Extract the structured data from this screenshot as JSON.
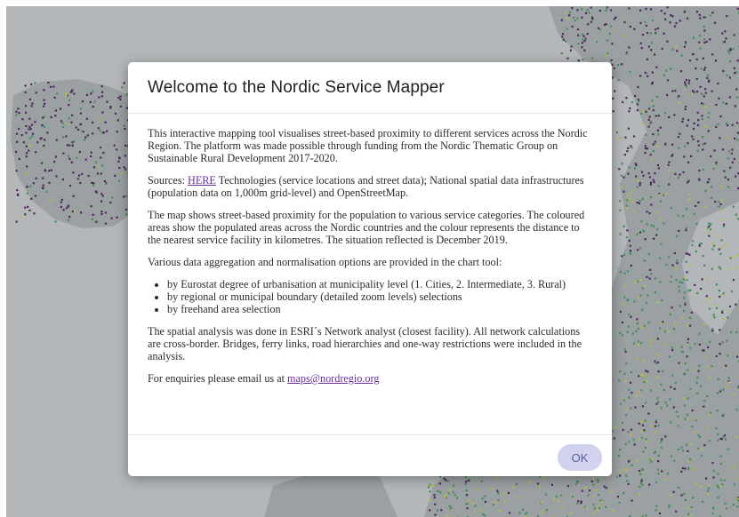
{
  "modal": {
    "title": "Welcome to the Nordic Service Mapper",
    "intro": "This interactive mapping tool visualises street-based proximity to different services across the Nordic Region. The platform was made possible through funding from the Nordic Thematic Group on Sustainable Rural Development 2017-2020.",
    "sources_prefix": "Sources: ",
    "sources_link": "HERE",
    "sources_rest": " Technologies (service locations and street data); National spatial data infrastructures (population data on 1,000m grid-level) and OpenStreetMap.",
    "map_description": "The map shows street-based proximity for the population to various service categories. The coloured areas show the populated areas across the Nordic countries and the colour represents the distance to the nearest service facility in kilometres. The situation reflected is December 2019.",
    "aggregation_intro": "Various data aggregation and normalisation options are provided in the chart tool:",
    "aggregation_options": [
      "by Eurostat degree of urbanisation at municipality level (1. Cities, 2. Intermediate, 3. Rural)",
      "by regional or municipal boundary (detailed zoom levels) selections",
      "by freehand area selection"
    ],
    "analysis_note": "The spatial analysis was done in ESRI´s Network analyst (closest facility). All network calculations are cross-border. Bridges, ferry links, road hierarchies and one-way restrictions were included in the analysis.",
    "enquiries_prefix": "For enquiries please email us at ",
    "enquiries_email": "maps@nordregio.org",
    "ok_label": "OK"
  },
  "colors": {
    "map_land": "#aab0b3",
    "map_water": "#c9cccf",
    "dots_purple": "#4b1f5e",
    "dots_green": "#3f9a5a",
    "dots_yellow": "#c9d43a",
    "ok_button_bg": "#d1d3ee",
    "ok_button_text": "#5a5f9e",
    "link": "#6a2ea0"
  }
}
